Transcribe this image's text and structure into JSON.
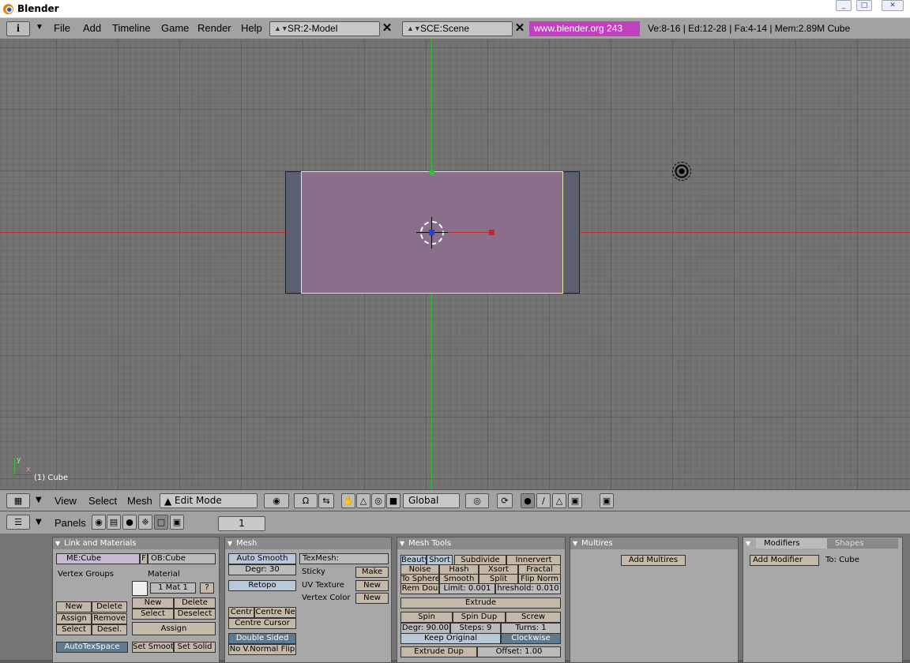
{
  "window": {
    "title": "Blender",
    "min": "_",
    "max": "□",
    "close": "✕"
  },
  "menubar": {
    "info_icon": "i",
    "items": [
      "File",
      "Add",
      "Timeline",
      "Game",
      "Render",
      "Help"
    ],
    "screen": "SR:2-Model",
    "scene": "SCE:Scene",
    "url": "www.blender.org 243",
    "stats": "Ve:8-16 | Ed:12-28 | Fa:4-14 | Mem:2.89M Cube"
  },
  "viewport": {
    "object_label": "(1) Cube",
    "axis_x": "x",
    "axis_y": "y",
    "colors": {
      "x_axis": "#c03030",
      "y_axis": "#30c030",
      "face": "#8a6e8a",
      "edge": "#e8e8a0"
    }
  },
  "toolbar3d": {
    "menus": [
      "View",
      "Select",
      "Mesh"
    ],
    "mode": "Edit Mode",
    "orientation": "Global"
  },
  "buttons_header": {
    "label": "Panels",
    "frame": "1"
  },
  "panels": {
    "link": {
      "title": "Link and Materials",
      "mesh_name": "ME:Cube",
      "f": "F",
      "ob_name": "OB:Cube",
      "vgroups": "Vertex Groups",
      "material": "Material",
      "mat_field": "1 Mat 1",
      "q": "?",
      "new": "New",
      "delete": "Delete",
      "assign": "Assign",
      "remove": "Remove",
      "select": "Select",
      "desel": "Desel.",
      "new2": "New",
      "delete2": "Delete",
      "select2": "Select",
      "deselect": "Deselect",
      "assign2": "Assign",
      "autotex": "AutoTexSpace",
      "setsmooth": "Set Smoot",
      "setsolid": "Set Solid"
    },
    "mesh": {
      "title": "Mesh",
      "autosmooth": "Auto Smooth",
      "degr": "Degr: 30",
      "retopo": "Retopo",
      "texmesh": "TexMesh:",
      "sticky": "Sticky",
      "make": "Make",
      "uvtex": "UV Texture",
      "new": "New",
      "vcol": "Vertex Color",
      "new2": "New",
      "centre": "Centr",
      "centrenew": "Centre Ne",
      "centrecursor": "Centre Cursor",
      "doublesided": "Double Sided",
      "novnormal": "No V.Normal Flip"
    },
    "tools": {
      "title": "Mesh Tools",
      "beauty": "Beauty",
      "short": "Short",
      "subdivide": "Subdivide",
      "innervert": "Innervert",
      "noise": "Noise",
      "hash": "Hash",
      "xsort": "Xsort",
      "fractal": "Fractal",
      "tosphere": "To Sphere",
      "smooth": "Smooth",
      "split": "Split",
      "flipnorm": "Flip Norm",
      "remdou": "Rem Dou",
      "limit": "Limit: 0.001",
      "threshold": "hreshold: 0.010",
      "extrude": "Extrude",
      "spin": "Spin",
      "spindup": "Spin Dup",
      "screw": "Screw",
      "degr": "Degr: 90.00",
      "steps": "Steps: 9",
      "turns": "Turns: 1",
      "keeporig": "Keep Original",
      "clockwise": "Clockwise",
      "extrudedup": "Extrude Dup",
      "offset": "Offset: 1.00"
    },
    "multires": {
      "title": "Multires",
      "add": "Add Multires"
    },
    "modifiers": {
      "tab1": "Modifiers",
      "tab2": "Shapes",
      "add": "Add Modifier",
      "to": "To: Cube"
    }
  }
}
